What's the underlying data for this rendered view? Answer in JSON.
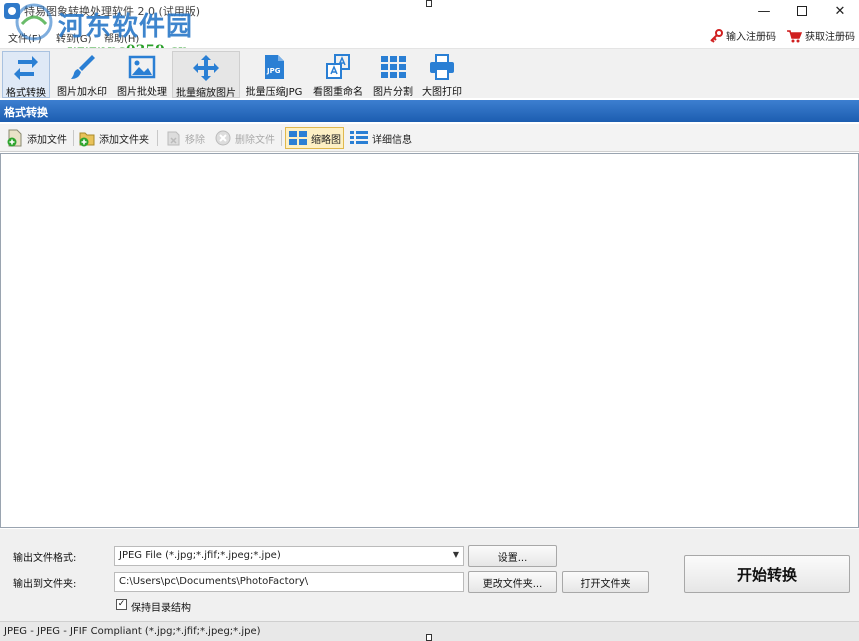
{
  "window": {
    "title": "特易图象转换处理软件 2.0 (试用版)",
    "minimize_glyph": "—",
    "close_glyph": "✕"
  },
  "watermark": {
    "title": "河东软件园",
    "url": "www.pc0359.cn"
  },
  "menu": {
    "items": [
      "文件(F)",
      "转到(G)",
      "帮助(H)"
    ],
    "register": "输入注册码",
    "buy": "获取注册码"
  },
  "toolbar": {
    "items": [
      {
        "label": "格式转换",
        "icon": "convert-icon"
      },
      {
        "label": "图片加水印",
        "icon": "brush-icon"
      },
      {
        "label": "图片批处理",
        "icon": "image-icon"
      },
      {
        "label": "批量缩放图片",
        "icon": "move-arrows-icon"
      },
      {
        "label": "批量压缩JPG",
        "icon": "jpg-file-icon"
      },
      {
        "label": "看图重命名",
        "icon": "rename-icon"
      },
      {
        "label": "图片分割",
        "icon": "grid-icon"
      },
      {
        "label": "大图打印",
        "icon": "printer-icon"
      }
    ],
    "jpg_badge": "JPG"
  },
  "section": {
    "title": "格式转换"
  },
  "subtoolbar": {
    "add_file": "添加文件",
    "add_folder": "添加文件夹",
    "remove": "移除",
    "delete_file": "删除文件",
    "thumbnail": "缩略图",
    "details": "详细信息"
  },
  "bottom": {
    "format_label": "输出文件格式:",
    "format_value": "JPEG File (*.jpg;*.jfif;*.jpeg;*.jpe)",
    "settings_button": "设置...",
    "output_label": "输出到文件夹:",
    "output_path": "C:\\Users\\pc\\Documents\\PhotoFactory\\",
    "change_folder_button": "更改文件夹...",
    "open_folder_button": "打开文件夹",
    "keep_structure_label": "保持目录结构",
    "keep_structure_checked": true,
    "start_button": "开始转换"
  },
  "status": {
    "text": "JPEG - JPEG - JFIF Compliant (*.jpg;*.jfif;*.jpeg;*.jpe)"
  },
  "colors": {
    "accent": "#1c5db0",
    "toolbar_icon": "#2a7fd4",
    "watermark_blue": "#2a78c8",
    "watermark_green": "#2ba02b"
  }
}
